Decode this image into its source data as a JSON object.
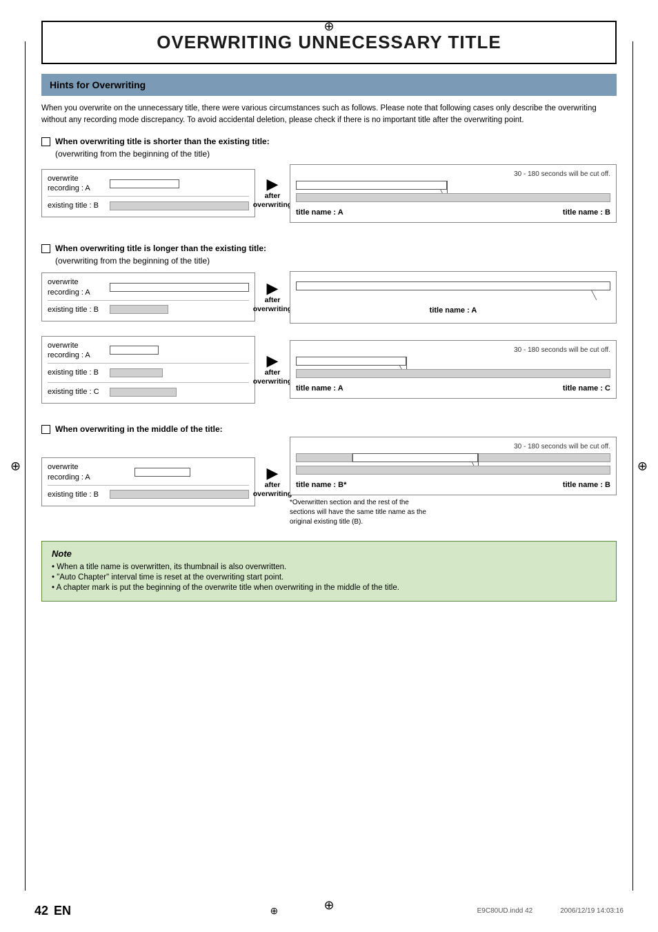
{
  "page": {
    "main_title": "OVERWRITING UNNECESSARY TITLE",
    "section_header": "Hints for Overwriting",
    "intro_text": "When you overwrite on the unnecessary title, there were various circumstances such as follows.  Please note that following cases only describe the overwriting without any recording mode discrepancy.  To avoid accidental deletion, please check if there is no important title after the overwriting point.",
    "reg_mark": "⊕",
    "sections": [
      {
        "id": "section1",
        "label": "When overwriting title is shorter than the existing title:",
        "sublabel": "(overwriting from the beginning of the title)",
        "left_rows": [
          {
            "label": "overwrite\nrecording : A",
            "bar_class": "overwrite-short"
          },
          {
            "divider": true
          },
          {
            "label": "existing title : B",
            "bar_class": "existing-long"
          }
        ],
        "after_label": "after\noverwriting",
        "right_cut_note": "30 - 180 seconds will be cut off.",
        "right_has_two_bars": true,
        "right_top_bar_width": "45%",
        "right_bottom_bar_width": "100%",
        "title_a_label": "title name : A",
        "title_b_label": "title name : B"
      },
      {
        "id": "section2",
        "label": "When overwriting title is longer than the existing title:",
        "sublabel": "(overwriting from the beginning of the title)",
        "left_rows": [
          {
            "label": "overwrite\nrecording : A",
            "bar_class": "overwrite-long"
          },
          {
            "divider": true
          },
          {
            "label": "existing title : B",
            "bar_class": "existing-short2"
          }
        ],
        "after_label": "after\noverwriting",
        "right_cut_note": "",
        "right_single_bar": true,
        "title_label": "title name : A"
      },
      {
        "id": "section2b",
        "left_rows": [
          {
            "label": "overwrite\nrecording : A",
            "bar_class": "overwrite-small"
          },
          {
            "divider": true
          },
          {
            "label": "existing title : B",
            "bar_class": "existing-short2"
          },
          {
            "divider": true
          },
          {
            "label": "existing title : C",
            "bar_class": "existing-short"
          }
        ],
        "after_label": "after\noverwriting",
        "right_cut_note": "30 - 180 seconds will be cut off.",
        "right_has_two_bars": true,
        "right_top_bar_width": "35%",
        "right_bottom_bar_width": "100%",
        "title_a_label": "title name : A",
        "title_b_label": "title name : C"
      },
      {
        "id": "section3",
        "label": "When overwriting in the middle of the title:",
        "left_rows": [
          {
            "label": "overwrite\nrecording : A",
            "bar_class": "mid-overwrite"
          },
          {
            "divider": true
          },
          {
            "label": "existing title : B",
            "bar_class": "existing-long"
          }
        ],
        "after_label": "after\noverwriting",
        "right_cut_note": "30 - 180 seconds will be cut off.",
        "right_has_two_bars": true,
        "right_top_bar_width_left": "20%",
        "right_top_bar_width_mid": "45%",
        "right_bottom_bar_width": "100%",
        "title_a_label": "title name : B*",
        "title_b_label": "title name : B",
        "footnote": "*Overwritten section and the rest of the sections will have the same title name as the original existing title (B)."
      }
    ],
    "note": {
      "title": "Note",
      "items": [
        "• When a title name is overwritten, its thumbnail is also overwritten.",
        "• \"Auto Chapter\" interval time is reset at the overwriting start point.",
        "• A chapter mark is put the beginning of the overwrite title when overwriting in the middle of the title."
      ]
    },
    "footer": {
      "page_num": "42",
      "lang": "EN",
      "filename": "E9C80UD.indd  42",
      "date": "2006/12/19   14:03:16"
    }
  }
}
